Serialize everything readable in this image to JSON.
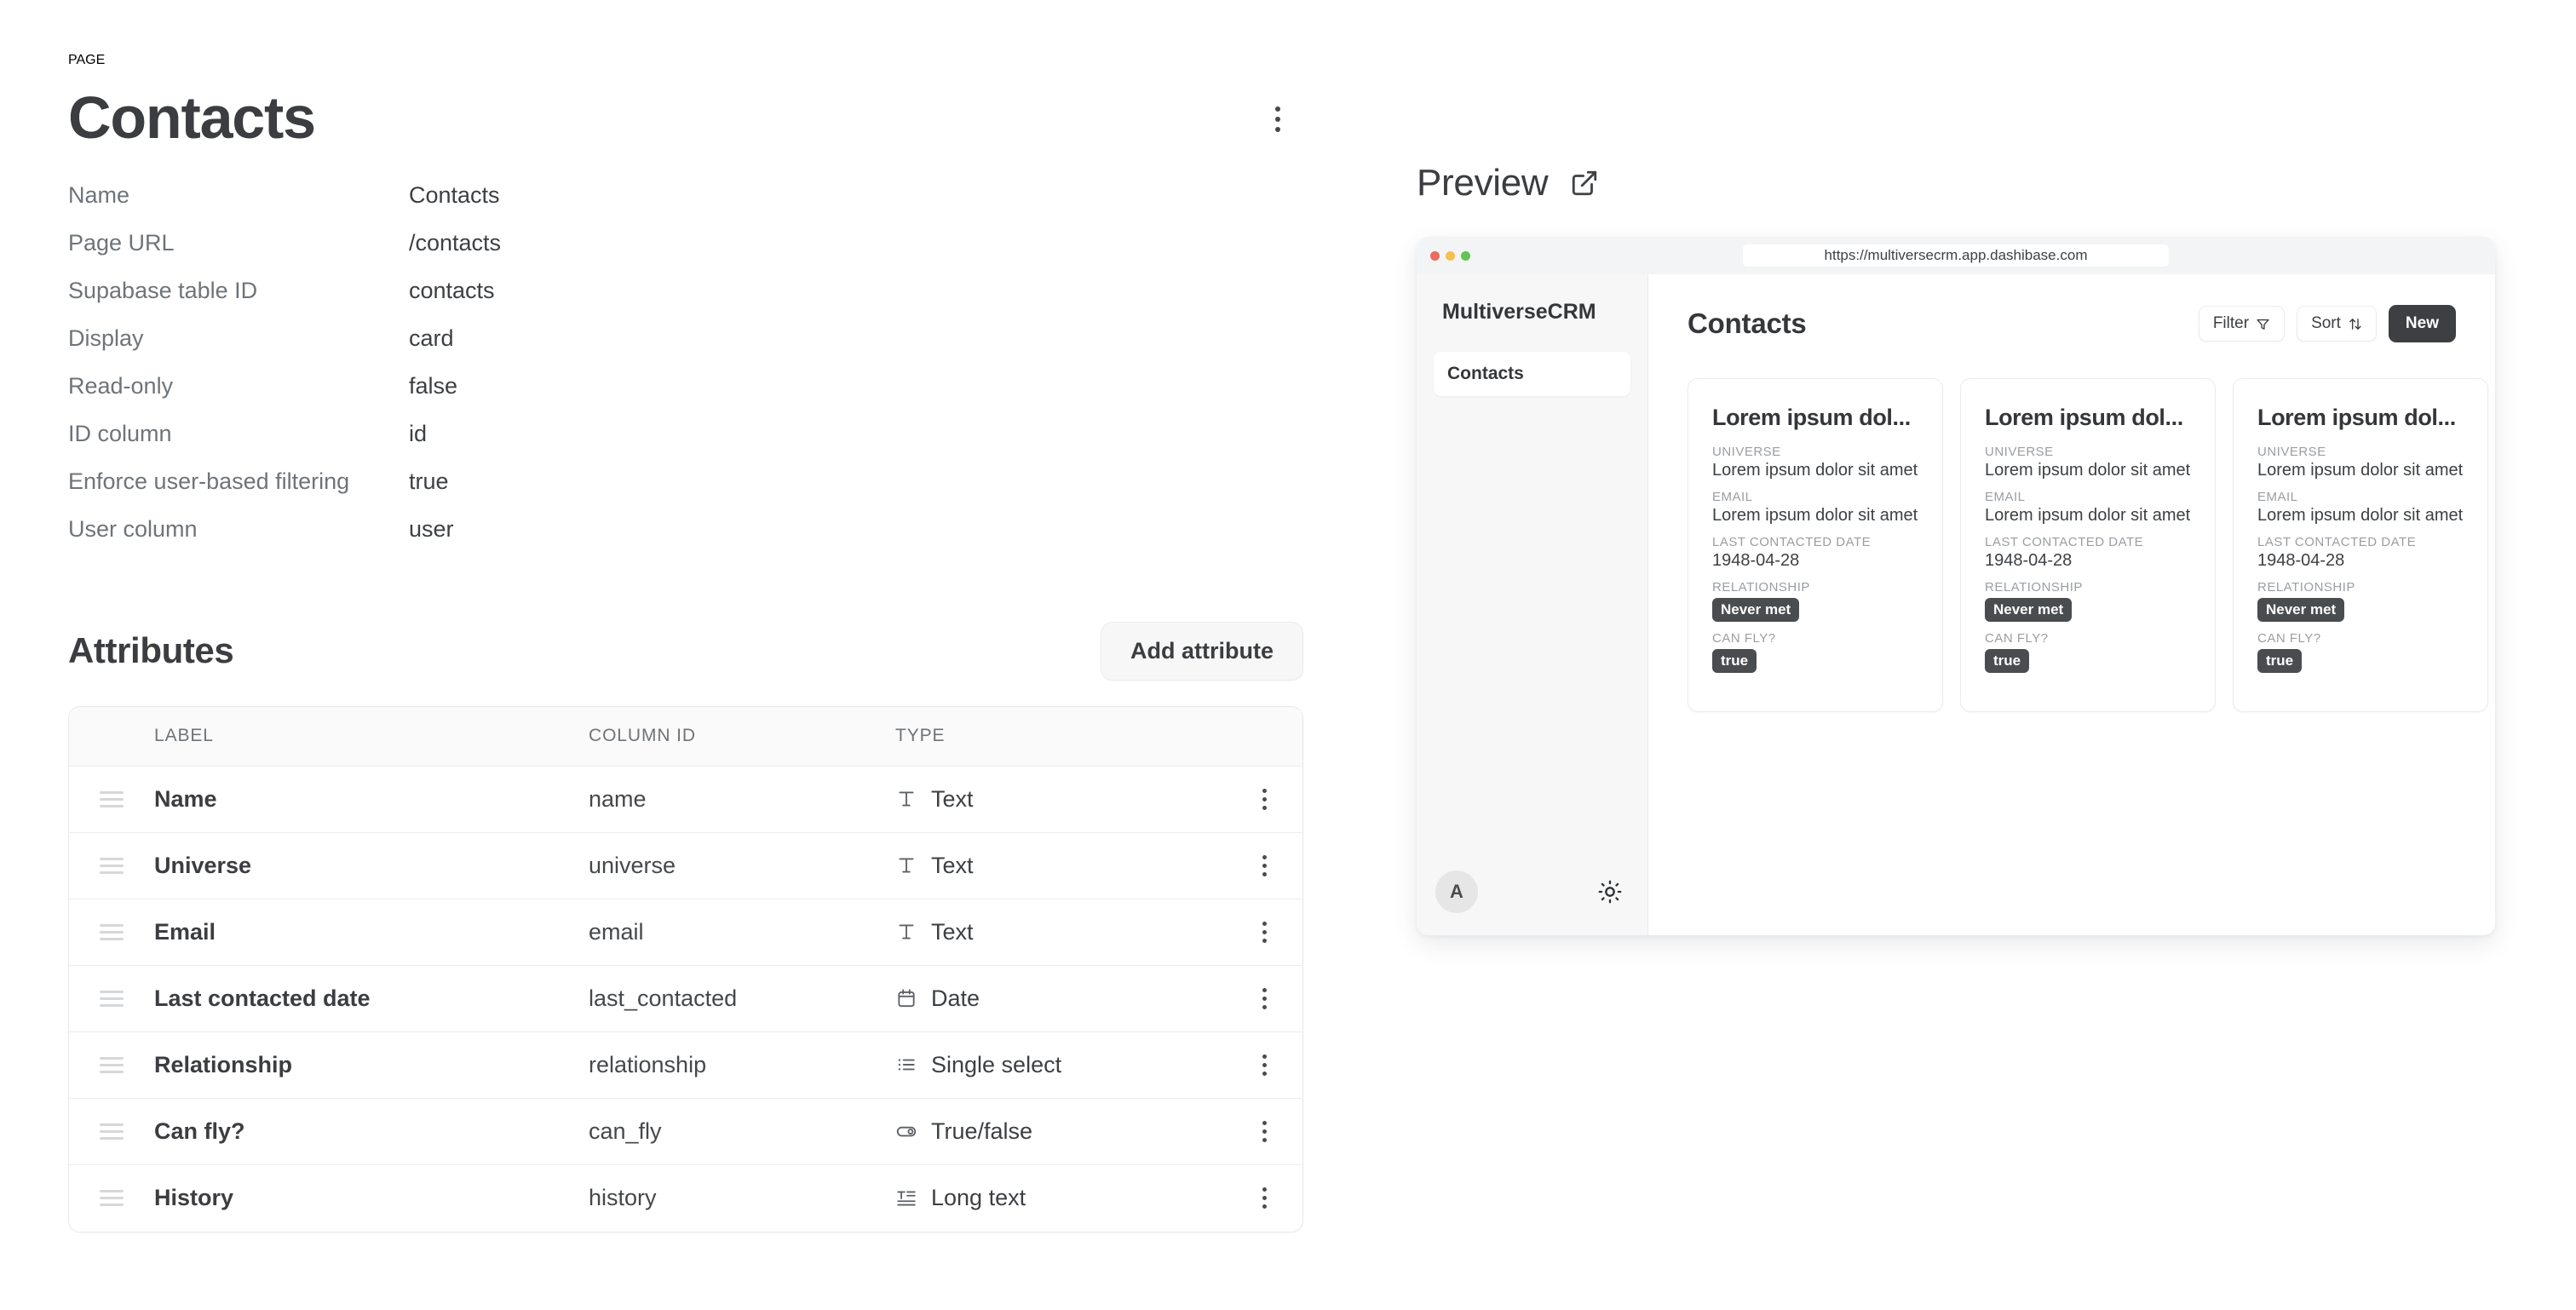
{
  "page": {
    "eyebrow": "PAGE",
    "title": "Contacts",
    "properties": [
      {
        "key": "Name",
        "value": "Contacts"
      },
      {
        "key": "Page URL",
        "value": "/contacts"
      },
      {
        "key": "Supabase table ID",
        "value": "contacts"
      },
      {
        "key": "Display",
        "value": "card"
      },
      {
        "key": "Read-only",
        "value": "false"
      },
      {
        "key": "ID column",
        "value": "id"
      },
      {
        "key": "Enforce user-based filtering",
        "value": "true"
      },
      {
        "key": "User column",
        "value": "user"
      }
    ]
  },
  "attributes": {
    "title": "Attributes",
    "add_button": "Add attribute",
    "columns": {
      "label": "LABEL",
      "column_id": "COLUMN ID",
      "type": "TYPE"
    },
    "rows": [
      {
        "label": "Name",
        "column_id": "name",
        "type": "Text",
        "icon": "text-icon"
      },
      {
        "label": "Universe",
        "column_id": "universe",
        "type": "Text",
        "icon": "text-icon"
      },
      {
        "label": "Email",
        "column_id": "email",
        "type": "Text",
        "icon": "text-icon"
      },
      {
        "label": "Last contacted date",
        "column_id": "last_contacted",
        "type": "Date",
        "icon": "calendar-icon"
      },
      {
        "label": "Relationship",
        "column_id": "relationship",
        "type": "Single select",
        "icon": "list-icon"
      },
      {
        "label": "Can fly?",
        "column_id": "can_fly",
        "type": "True/false",
        "icon": "toggle-icon"
      },
      {
        "label": "History",
        "column_id": "history",
        "type": "Long text",
        "icon": "long-text-icon"
      }
    ]
  },
  "preview": {
    "title": "Preview",
    "open_icon": "external-link-icon",
    "browser": {
      "url": "https://multiversecrm.app.dashibase.com",
      "traffic_colors": [
        "#ec6a5e",
        "#f5bf4f",
        "#61c454"
      ]
    },
    "app": {
      "brand": "MultiverseCRM",
      "nav_items": [
        "Contacts"
      ],
      "avatar_initial": "A",
      "theme_icon": "sun-icon",
      "main_title": "Contacts",
      "actions": {
        "filter": "Filter",
        "sort": "Sort",
        "new": "New"
      },
      "cards": [
        {
          "title": "Lorem ipsum dol...",
          "fields": [
            {
              "key": "UNIVERSE",
              "value": "Lorem ipsum dolor sit amet",
              "kind": "text"
            },
            {
              "key": "EMAIL",
              "value": "Lorem ipsum dolor sit amet",
              "kind": "text"
            },
            {
              "key": "LAST CONTACTED DATE",
              "value": "1948-04-28",
              "kind": "text"
            },
            {
              "key": "RELATIONSHIP",
              "value": "Never met",
              "kind": "tag"
            },
            {
              "key": "CAN FLY?",
              "value": "true",
              "kind": "tag"
            }
          ]
        },
        {
          "title": "Lorem ipsum dol...",
          "fields": [
            {
              "key": "UNIVERSE",
              "value": "Lorem ipsum dolor sit amet",
              "kind": "text"
            },
            {
              "key": "EMAIL",
              "value": "Lorem ipsum dolor sit amet",
              "kind": "text"
            },
            {
              "key": "LAST CONTACTED DATE",
              "value": "1948-04-28",
              "kind": "text"
            },
            {
              "key": "RELATIONSHIP",
              "value": "Never met",
              "kind": "tag"
            },
            {
              "key": "CAN FLY?",
              "value": "true",
              "kind": "tag"
            }
          ]
        },
        {
          "title": "Lorem ipsum dol...",
          "fields": [
            {
              "key": "UNIVERSE",
              "value": "Lorem ipsum dolor sit amet",
              "kind": "text"
            },
            {
              "key": "EMAIL",
              "value": "Lorem ipsum dolor sit amet",
              "kind": "text"
            },
            {
              "key": "LAST CONTACTED DATE",
              "value": "1948-04-28",
              "kind": "text"
            },
            {
              "key": "RELATIONSHIP",
              "value": "Never met",
              "kind": "tag"
            },
            {
              "key": "CAN FLY?",
              "value": "true",
              "kind": "tag"
            }
          ]
        }
      ]
    }
  },
  "colors": {
    "accent_dark": "#3d3f42",
    "text_primary": "#3b3d40",
    "text_muted": "#6e7479",
    "surface": "#ffffff",
    "surface_alt": "#f7f7f8"
  }
}
